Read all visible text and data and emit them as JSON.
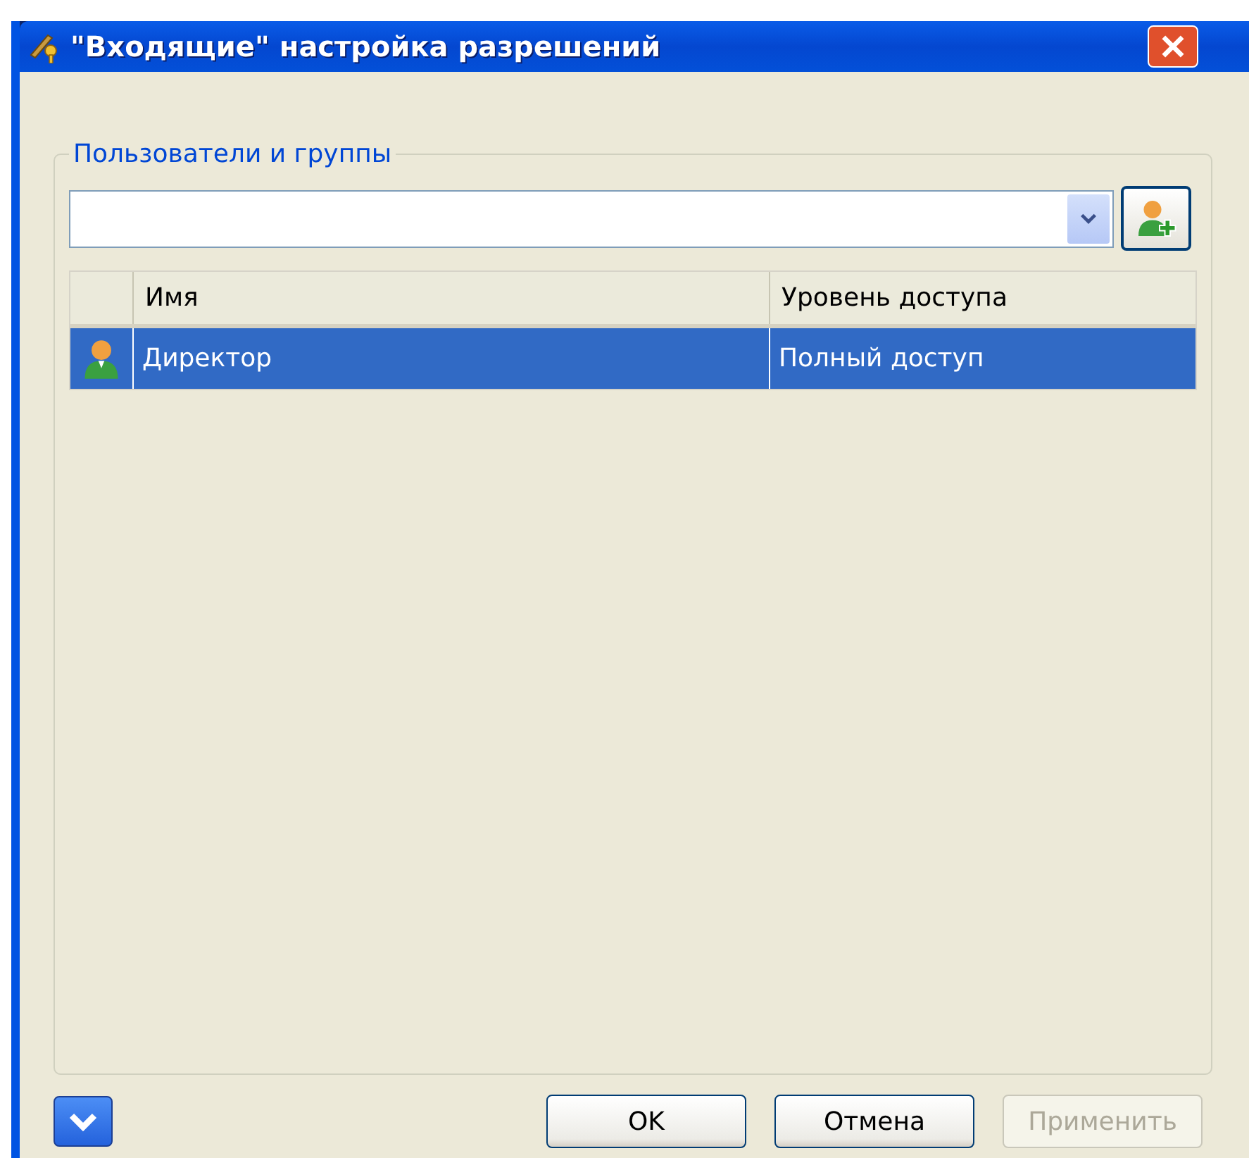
{
  "window": {
    "title": "\"Входящие\" настройка разрешений"
  },
  "group": {
    "label": "Пользователи и группы"
  },
  "table": {
    "columns": [
      "Имя",
      "Уровень доступа"
    ],
    "rows": [
      {
        "name": "Директор",
        "access": "Полный доступ",
        "selected": true
      }
    ]
  },
  "buttons": [
    {
      "label": "OK",
      "disabled": false
    },
    {
      "label": "Отмена",
      "disabled": false
    },
    {
      "label": "Применить",
      "disabled": true
    }
  ]
}
